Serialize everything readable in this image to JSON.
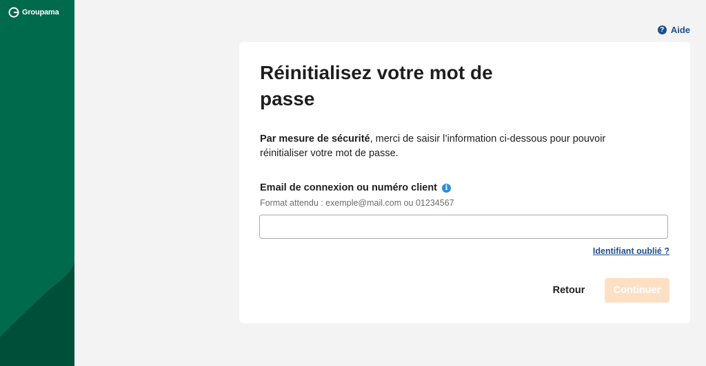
{
  "brand": {
    "name": "Groupama",
    "color": "#006a4d",
    "dark_color": "#004f38"
  },
  "header": {
    "help_label": "Aide",
    "help_icon": "question-circle-icon"
  },
  "form": {
    "title": "Réinitialisez votre mot de passe",
    "intro_bold": "Par mesure de sécurité",
    "intro_rest": ", merci de saisir l’information ci-dessous pour pouvoir réinitialiser votre mot de passe.",
    "field_label": "Email de connexion ou numéro client",
    "field_icon": "info-icon",
    "field_hint": "Format attendu : exemple@mail.com ou 01234567",
    "field_value": "",
    "forgot_link": "Identifiant oublié ?",
    "back_label": "Retour",
    "continue_label": "Continuer",
    "continue_disabled": true,
    "accent_color": "#fde0c4",
    "link_color": "#1d4f8c"
  }
}
